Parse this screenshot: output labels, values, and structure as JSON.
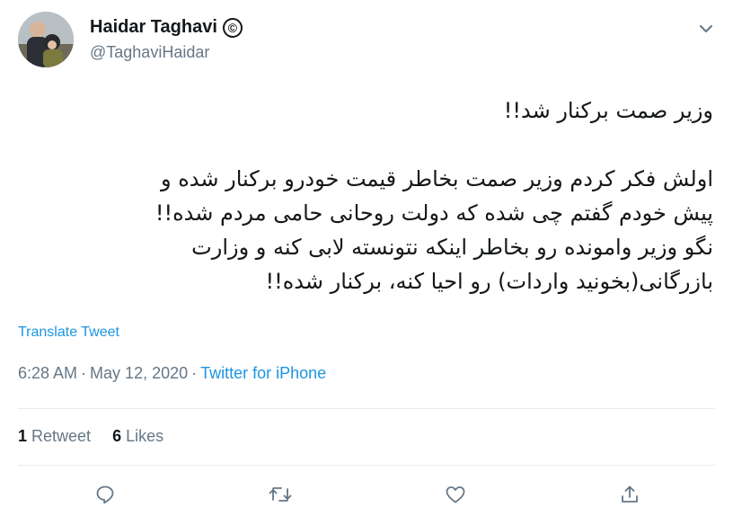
{
  "author": {
    "name": "Haidar Taghavi",
    "badge": "©",
    "handle": "@TaghaviHaidar"
  },
  "tweet": {
    "lines": [
      "وزیر صمت برکنار شد!!",
      "",
      "اولش فکر کردم وزیر صمت بخاطر قیمت خودرو برکنار شده و",
      "پیش خودم گفتم چی شده که دولت روحانی حامی مردم شده!!",
      "نگو وزیر وامونده رو بخاطر اینکه نتونسته لابی کنه و وزارت",
      "بازرگانی(بخونید واردات) رو احیا کنه، برکنار شده!!"
    ],
    "translate_label": "Translate Tweet",
    "time": "6:28 AM",
    "separator": "·",
    "date": "May 12, 2020",
    "source": "Twitter for iPhone"
  },
  "stats": {
    "retweets_count": "1",
    "retweets_label": "Retweet",
    "likes_count": "6",
    "likes_label": "Likes"
  },
  "actions": {
    "icons": [
      "reply-icon",
      "retweet-icon",
      "like-icon",
      "share-icon"
    ]
  },
  "colors": {
    "link": "#1b95e0",
    "secondary_text": "#657786",
    "primary_text": "#14171a",
    "divider": "#e6ecf0"
  }
}
